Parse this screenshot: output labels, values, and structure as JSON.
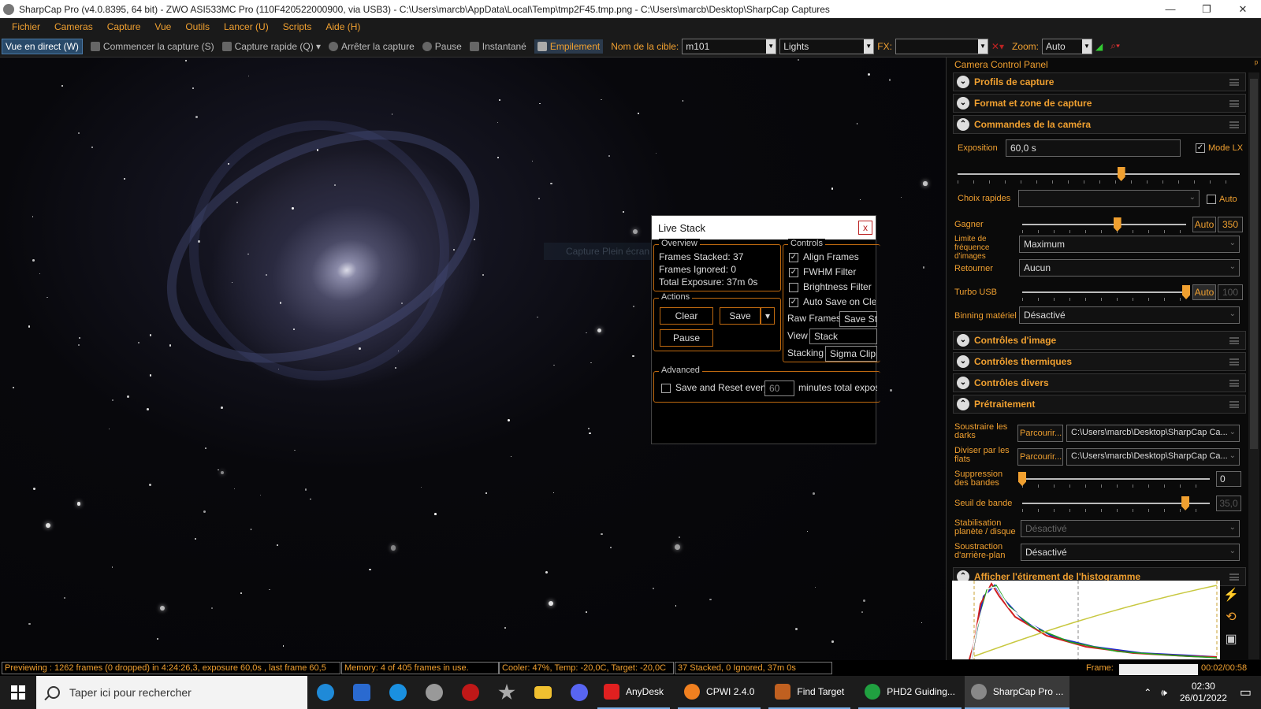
{
  "window": {
    "title": "SharpCap Pro (v4.0.8395, 64 bit) - ZWO ASI533MC Pro (110F420522000900, via USB3) - C:\\Users\\marcb\\AppData\\Local\\Temp\\tmp2F45.tmp.png - C:\\Users\\marcb\\Desktop\\SharpCap Captures",
    "minimize": "—",
    "maximize": "❐",
    "close": "✕"
  },
  "menu": [
    "Fichier",
    "Cameras",
    "Capture",
    "Vue",
    "Outils",
    "Lancer (U)",
    "Scripts",
    "Aide (H)"
  ],
  "toolbar": {
    "live": "Vue en direct (W)",
    "start_capture": "Commencer la capture (S)",
    "quick_capture": "Capture rapide (Q)",
    "stop_capture": "Arrêter la capture",
    "pause": "Pause",
    "snapshot": "Instantané",
    "stacking": "Empilement",
    "target_label": "Nom de la cible:",
    "target_value": "m101",
    "frame_type": "Lights",
    "fx_label": "FX:",
    "fx_value": "",
    "zoom_label": "Zoom:",
    "zoom_value": "Auto"
  },
  "viewport": {
    "ghost_text": "Capture Plein écran"
  },
  "live_stack": {
    "title": "Live Stack",
    "close": "x",
    "overview": {
      "legend": "Overview",
      "frames_stacked": "Frames Stacked: 37",
      "frames_ignored": "Frames Ignored:  0",
      "total_exposure": "Total Exposure:  37m 0s"
    },
    "actions": {
      "legend": "Actions",
      "clear": "Clear",
      "save": "Save",
      "pause": "Pause"
    },
    "controls": {
      "legend": "Controls",
      "align_frames": "Align Frames",
      "fwhm_filter": "FWHM Filter",
      "brightness_filter": "Brightness Filter",
      "auto_save": "Auto Save on Clea",
      "raw_frames_label": "Raw Frames",
      "raw_frames_value": "Save St",
      "view_label": "View",
      "view_value": "Stack",
      "stacking_label": "Stacking",
      "stacking_value": "Sigma Clipp"
    },
    "advanced": {
      "legend": "Advanced",
      "save_reset": "Save and Reset every",
      "minutes_value": "60",
      "minutes_label": "minutes total exposu"
    }
  },
  "panel": {
    "title": "Camera Control Panel",
    "pin": "ᵖ",
    "sections": {
      "profiles": "Profils de capture",
      "format": "Format et zone de capture",
      "camera_controls": "Commandes de la caméra",
      "image_controls": "Contrôles d'image",
      "thermal": "Contrôles thermiques",
      "misc": "Contrôles divers",
      "preprocessing": "Prétraitement",
      "histogram": "Afficher l'étirement de l'histogramme"
    },
    "camera": {
      "exposure_label": "Exposition",
      "exposure_value": "60,0 s",
      "lx_mode": "Mode LX",
      "quick_choice_label": "Choix rapides",
      "quick_choice_value": "",
      "auto_label": "Auto",
      "gain_label": "Gagner",
      "gain_auto": "Auto",
      "gain_value": "350",
      "gain_level": 0.58,
      "exposure_level": 0.58,
      "frame_limit_label": "Limite de fréquence d'images",
      "frame_limit_value": "Maximum",
      "flip_label": "Retourner",
      "flip_value": "Aucun",
      "turbo_label": "Turbo USB",
      "turbo_auto": "Auto",
      "turbo_value": "100",
      "turbo_level": 1.0,
      "binning_label": "Binning matériel",
      "binning_value": "Désactivé"
    },
    "pre": {
      "darks_label": "Soustraire les darks",
      "browse": "Parcourir...",
      "darks_path": "C:\\Users\\marcb\\Desktop\\SharpCap Ca...",
      "flats_label": "Diviser par les flats",
      "flats_path": "C:\\Users\\marcb\\Desktop\\SharpCap Ca...",
      "banding_label": "Suppression des bandes",
      "banding_value": "0",
      "banding_level": 0.0,
      "threshold_label": "Seuil de bande",
      "threshold_value": "35,0",
      "threshold_level": 0.87,
      "planet_label": "Stabilisation planète / disque",
      "planet_value": "Désactivé",
      "background_label": "Soustraction d'arrière-plan",
      "background_value": "Désactivé"
    }
  },
  "status": {
    "preview": "Previewing : 1262 frames (0 dropped) in 4:24:26,3, exposure 60,0s , last frame 60,5",
    "memory": "Memory: 4 of 405 frames in use.",
    "cooler": "Cooler: 47%, Temp: -20,0C, Target: -20,0C",
    "stacked": "37 Stacked, 0 Ignored, 37m 0s",
    "frame_label": "Frame:",
    "time": "00:02/00:58"
  },
  "taskbar": {
    "search": "Taper ici pour rechercher",
    "apps": [
      "AnyDesk",
      "CPWI 2.4.0",
      "Find Target",
      "PHD2 Guiding...",
      "SharpCap Pro ..."
    ],
    "time": "02:30",
    "date": "26/01/2022"
  },
  "colors": {
    "accent": "#f0a030",
    "border_orange": "#c06a10"
  }
}
